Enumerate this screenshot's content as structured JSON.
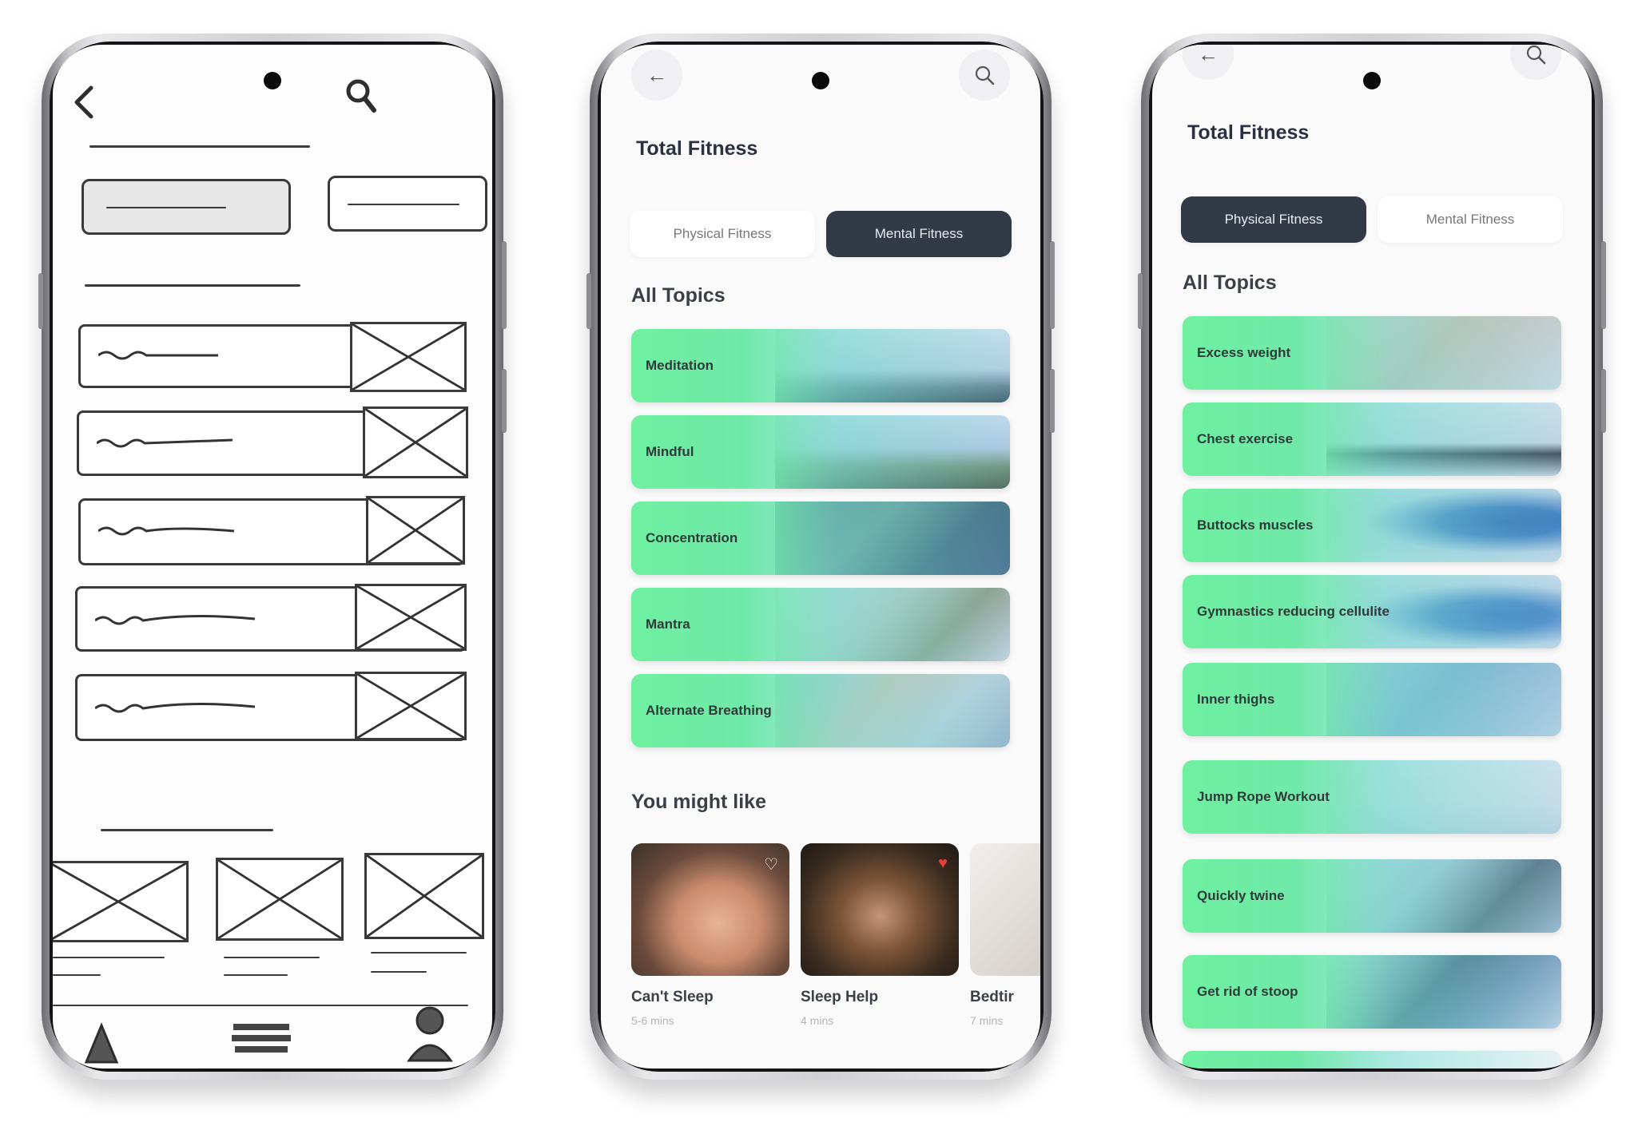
{
  "app": {
    "title": "Total Fitness"
  },
  "screen2": {
    "tabs": [
      {
        "label": "Physical Fitness",
        "active": false
      },
      {
        "label": "Mental Fitness",
        "active": true
      }
    ],
    "section_title": "All Topics",
    "topics": [
      {
        "label": "Meditation"
      },
      {
        "label": "Mindful"
      },
      {
        "label": "Concentration"
      },
      {
        "label": "Mantra"
      },
      {
        "label": "Alternate Breathing"
      }
    ],
    "you_might_like": {
      "title": "You might like",
      "cards": [
        {
          "title": "Can't Sleep",
          "duration": "5-6 mins",
          "favorite": false
        },
        {
          "title": "Sleep Help",
          "duration": "4 mins",
          "favorite": true
        },
        {
          "title": "Bedtir",
          "duration": "7 mins",
          "favorite": false
        }
      ]
    }
  },
  "screen3": {
    "tabs": [
      {
        "label": "Physical Fitness",
        "active": true
      },
      {
        "label": "Mental Fitness",
        "active": false
      }
    ],
    "section_title": "All Topics",
    "topics": [
      {
        "label": "Excess weight"
      },
      {
        "label": "Chest exercise"
      },
      {
        "label": "Buttocks muscles"
      },
      {
        "label": "Gymnastics reducing cellulite"
      },
      {
        "label": "Inner thighs"
      },
      {
        "label": "Jump Rope Workout"
      },
      {
        "label": "Quickly twine"
      },
      {
        "label": "Get rid of stoop"
      }
    ]
  },
  "colors": {
    "accent_green": "#6ef0a0",
    "accent_teal": "#7fd6d8",
    "dark_tab": "#323a48",
    "heart_red": "#e0413b"
  },
  "icons": {
    "back": "arrow-left-icon",
    "search": "search-icon",
    "heart": "heart-icon"
  }
}
